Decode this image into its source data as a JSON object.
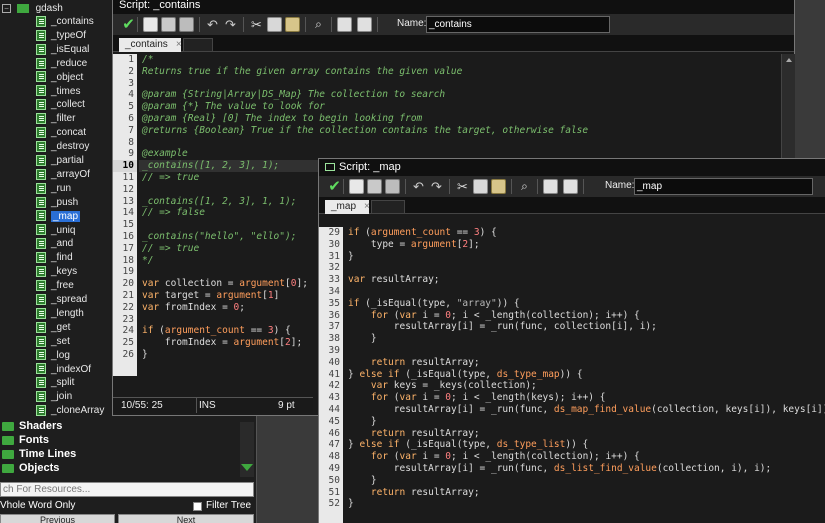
{
  "tree": {
    "root_label": "gdash",
    "scripts": [
      {
        "label": "_contains"
      },
      {
        "label": "_typeOf"
      },
      {
        "label": "_isEqual"
      },
      {
        "label": "_reduce"
      },
      {
        "label": "_object"
      },
      {
        "label": "_times"
      },
      {
        "label": "_collect"
      },
      {
        "label": "_filter"
      },
      {
        "label": "_concat"
      },
      {
        "label": "_destroy"
      },
      {
        "label": "_partial"
      },
      {
        "label": "_arrayOf"
      },
      {
        "label": "_run"
      },
      {
        "label": "_push"
      },
      {
        "label": "_map"
      },
      {
        "label": "_uniq"
      },
      {
        "label": "_and"
      },
      {
        "label": "_find"
      },
      {
        "label": "_keys"
      },
      {
        "label": "_free"
      },
      {
        "label": "_spread"
      },
      {
        "label": "_length"
      },
      {
        "label": "_get"
      },
      {
        "label": "_set"
      },
      {
        "label": "_log"
      },
      {
        "label": "_indexOf"
      },
      {
        "label": "_split"
      },
      {
        "label": "_join"
      },
      {
        "label": "_cloneArray"
      }
    ],
    "selected_index": 14,
    "groups": [
      {
        "label": "Shaders"
      },
      {
        "label": "Fonts"
      },
      {
        "label": "Time Lines"
      },
      {
        "label": "Objects"
      }
    ],
    "search_placeholder": "ch For Resources...",
    "whole_word_label": "Vhole Word Only",
    "filter_tree_label": "Filter Tree",
    "prev_label": "Previous",
    "next_label": "Next"
  },
  "win1": {
    "title": "Script: _contains",
    "name_label": "Name:",
    "name_value": "_contains",
    "tab_label": "_contains",
    "tab_close": "×",
    "status": {
      "pos": "10/55:  25",
      "mode": "INS",
      "size": "9 pt"
    },
    "lines": [
      [
        {
          "t": "/*",
          "c": "c"
        }
      ],
      [
        {
          "t": "Returns true if the given array contains the given value",
          "c": "c"
        }
      ],
      [],
      [
        {
          "t": "@param {String|Array|DS_Map} The collection to search",
          "c": "c"
        }
      ],
      [
        {
          "t": "@param {*} The value to look for",
          "c": "c"
        }
      ],
      [
        {
          "t": "@param {Real} [0] The index to begin looking from",
          "c": "c"
        }
      ],
      [
        {
          "t": "@returns {Boolean} True if the collection contains the target, otherwise false",
          "c": "c"
        }
      ],
      [],
      [
        {
          "t": "@example",
          "c": "c"
        }
      ],
      [
        {
          "t": "_contains([1, 2, 3], 1);",
          "c": "c"
        }
      ],
      [
        {
          "t": "// => true",
          "c": "c"
        }
      ],
      [],
      [
        {
          "t": "_contains([1, 2, 3], 1, 1);",
          "c": "c"
        }
      ],
      [
        {
          "t": "// => false",
          "c": "c"
        }
      ],
      [],
      [
        {
          "t": "_contains(\"hello\", \"ello\");",
          "c": "c"
        }
      ],
      [
        {
          "t": "// => true",
          "c": "c"
        }
      ],
      [
        {
          "t": "*/",
          "c": "c"
        }
      ],
      [],
      [
        {
          "t": "var",
          "c": "k"
        },
        {
          "t": " collection = "
        },
        {
          "t": "argument",
          "c": "f"
        },
        {
          "t": "["
        },
        {
          "t": "0",
          "c": "n"
        },
        {
          "t": "];"
        }
      ],
      [
        {
          "t": "var",
          "c": "k"
        },
        {
          "t": " target = "
        },
        {
          "t": "argument",
          "c": "f"
        },
        {
          "t": "["
        },
        {
          "t": "1",
          "c": "n"
        },
        {
          "t": "]"
        }
      ],
      [
        {
          "t": "var",
          "c": "k"
        },
        {
          "t": " fromIndex = "
        },
        {
          "t": "0",
          "c": "n"
        },
        {
          "t": ";"
        }
      ],
      [],
      [
        {
          "t": "if",
          "c": "k"
        },
        {
          "t": " ("
        },
        {
          "t": "argument_count",
          "c": "f"
        },
        {
          "t": " == "
        },
        {
          "t": "3",
          "c": "n"
        },
        {
          "t": ") {"
        }
      ],
      [
        {
          "t": "    fromIndex = "
        },
        {
          "t": "argument",
          "c": "f"
        },
        {
          "t": "["
        },
        {
          "t": "2",
          "c": "n"
        },
        {
          "t": "];"
        }
      ],
      [
        {
          "t": "}"
        }
      ]
    ],
    "line_numbers": [
      "1",
      "2",
      "3",
      "4",
      "5",
      "6",
      "7",
      "8",
      "9",
      "10",
      "11",
      "12",
      "13",
      "14",
      "15",
      "16",
      "17",
      "18",
      "19",
      "20",
      "21",
      "22",
      "23",
      "24",
      "25",
      "26"
    ],
    "current_line_index": 9
  },
  "win2": {
    "title": "Script: _map",
    "name_label": "Name:",
    "name_value": "_map",
    "tab_label": "_map",
    "tab_close": "×",
    "line_numbers": [
      "29",
      "30",
      "31",
      "32",
      "33",
      "34",
      "35",
      "36",
      "37",
      "38",
      "39",
      "40",
      "41",
      "42",
      "43",
      "44",
      "45",
      "46",
      "47",
      "48",
      "49",
      "50",
      "51",
      "52"
    ],
    "lines": [
      [
        {
          "t": "if",
          "c": "k"
        },
        {
          "t": " ("
        },
        {
          "t": "argument_count",
          "c": "f"
        },
        {
          "t": " == "
        },
        {
          "t": "3",
          "c": "n"
        },
        {
          "t": ") {"
        }
      ],
      [
        {
          "t": "    type = "
        },
        {
          "t": "argument",
          "c": "f"
        },
        {
          "t": "["
        },
        {
          "t": "2",
          "c": "n"
        },
        {
          "t": "];"
        }
      ],
      [
        {
          "t": "}"
        }
      ],
      [],
      [
        {
          "t": "var",
          "c": "k"
        },
        {
          "t": " resultArray;"
        }
      ],
      [],
      [
        {
          "t": "if",
          "c": "k"
        },
        {
          "t": " (_isEqual(type, "
        },
        {
          "t": "\"array\"",
          "c": "s"
        },
        {
          "t": ")) {"
        }
      ],
      [
        {
          "t": "    "
        },
        {
          "t": "for",
          "c": "k"
        },
        {
          "t": " ("
        },
        {
          "t": "var",
          "c": "k"
        },
        {
          "t": " i = "
        },
        {
          "t": "0",
          "c": "n"
        },
        {
          "t": "; i < _length(collection); i++) {"
        }
      ],
      [
        {
          "t": "        resultArray[i] = _run(func, collection[i], i);"
        }
      ],
      [
        {
          "t": "    }"
        }
      ],
      [],
      [
        {
          "t": "    "
        },
        {
          "t": "return",
          "c": "k"
        },
        {
          "t": " resultArray;"
        }
      ],
      [
        {
          "t": "} "
        },
        {
          "t": "else if",
          "c": "k"
        },
        {
          "t": " (_isEqual(type, "
        },
        {
          "t": "ds_type_map",
          "c": "f"
        },
        {
          "t": ")) {"
        }
      ],
      [
        {
          "t": "    "
        },
        {
          "t": "var",
          "c": "k"
        },
        {
          "t": " keys = _keys(collection);"
        }
      ],
      [
        {
          "t": "    "
        },
        {
          "t": "for",
          "c": "k"
        },
        {
          "t": " ("
        },
        {
          "t": "var",
          "c": "k"
        },
        {
          "t": " i = "
        },
        {
          "t": "0",
          "c": "n"
        },
        {
          "t": "; i < _length(keys); i++) {"
        }
      ],
      [
        {
          "t": "        resultArray[i] = _run(func, "
        },
        {
          "t": "ds_map_find_value",
          "c": "f"
        },
        {
          "t": "(collection, keys[i]), keys[i]);"
        }
      ],
      [
        {
          "t": "    }"
        }
      ],
      [
        {
          "t": "    "
        },
        {
          "t": "return",
          "c": "k"
        },
        {
          "t": " resultArray;"
        }
      ],
      [
        {
          "t": "} "
        },
        {
          "t": "else if",
          "c": "k"
        },
        {
          "t": " (_isEqual(type, "
        },
        {
          "t": "ds_type_list",
          "c": "f"
        },
        {
          "t": ")) {"
        }
      ],
      [
        {
          "t": "    "
        },
        {
          "t": "for",
          "c": "k"
        },
        {
          "t": " ("
        },
        {
          "t": "var",
          "c": "k"
        },
        {
          "t": " i = "
        },
        {
          "t": "0",
          "c": "n"
        },
        {
          "t": "; i < _length(collection); i++) {"
        }
      ],
      [
        {
          "t": "        resultArray[i] = _run(func, "
        },
        {
          "t": "ds_list_find_value",
          "c": "f"
        },
        {
          "t": "(collection, i), i);"
        }
      ],
      [
        {
          "t": "    }"
        }
      ],
      [
        {
          "t": "    "
        },
        {
          "t": "return",
          "c": "k"
        },
        {
          "t": " resultArray;"
        }
      ],
      [
        {
          "t": "}"
        }
      ]
    ]
  },
  "toolbar_icons": [
    "ok-check-icon",
    "new-icon",
    "save-icon",
    "print-icon",
    "undo-icon",
    "redo-icon",
    "cut-icon",
    "copy-icon",
    "paste-icon",
    "find-icon",
    "goto-icon",
    "info-icon"
  ],
  "colors": {
    "comment": "#7cbf6e",
    "keyword": "#ffb46a",
    "builtin": "#ff9e5c",
    "number": "#ff8080",
    "selection": "#2a6fd6"
  }
}
